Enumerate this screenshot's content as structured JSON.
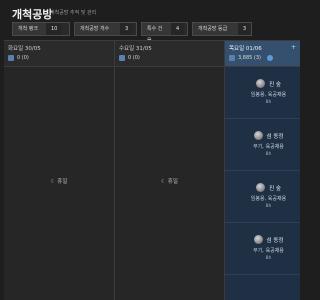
{
  "header": {
    "title": "개척공방",
    "subtitle": "개척공방 추적 및 관리"
  },
  "stats": [
    {
      "label": "개척 랭크",
      "value": "10"
    },
    {
      "label": "개척공방 개수",
      "value": "3"
    },
    {
      "label": "특수 건물",
      "value": "4"
    },
    {
      "label": "개척공방 등급",
      "value": "3"
    }
  ],
  "columns": [
    {
      "date": "화요일 30/05",
      "count": "0 (0)",
      "rest": "휴일"
    },
    {
      "date": "수요일 31/05",
      "count": "0 (0)",
      "rest": "휴일"
    },
    {
      "date": "목요일 01/06",
      "add": "+",
      "count": "3,885 (3)"
    }
  ],
  "slots": [
    {
      "name": "진 숲",
      "role": "임봉용, 육공채용",
      "duration": "8h"
    },
    {
      "name": "섬 동정",
      "role": "무기, 육공채용",
      "duration": "8h"
    },
    {
      "name": "진 숲",
      "role": "임봉용, 육공채용",
      "duration": "8h"
    },
    {
      "name": "섬 동정",
      "role": "무기, 육공채용",
      "duration": "8h"
    }
  ],
  "colors": {
    "background": "#1e1e1e",
    "today_header": "#34506e",
    "today_body": "#1f2f44",
    "accent": "#5d9bd8"
  }
}
